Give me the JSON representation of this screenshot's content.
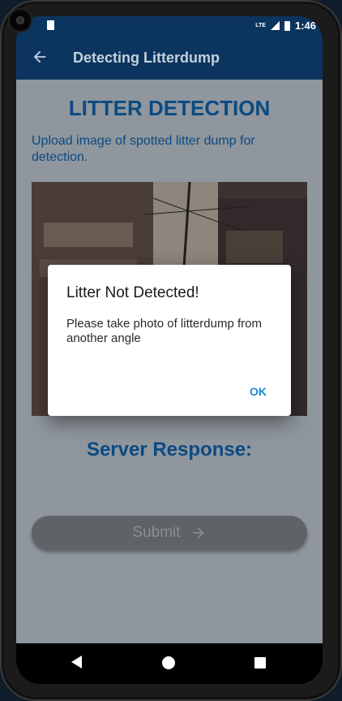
{
  "status_bar": {
    "time": "1:46",
    "network": "LTE"
  },
  "app_bar": {
    "title": "Detecting Litterdump"
  },
  "main": {
    "heading": "LITTER DETECTION",
    "subtitle": "Upload image of spotted litter dump for detection.",
    "server_response_label": "Server Response:",
    "submit_label": "Submit"
  },
  "dialog": {
    "title": "Litter Not Detected!",
    "message": "Please take photo of litterdump from another angle",
    "ok_label": "OK"
  },
  "icons": {
    "back": "arrow-left-icon",
    "submit_arrow": "arrow-right-icon",
    "nav_back": "triangle-back-icon",
    "nav_home": "circle-home-icon",
    "nav_recents": "square-recents-icon"
  },
  "colors": {
    "app_bar": "#0b355e",
    "heading": "#0b4a83",
    "scrim_background": "#8f969d",
    "ok_button": "#1a88d6"
  }
}
